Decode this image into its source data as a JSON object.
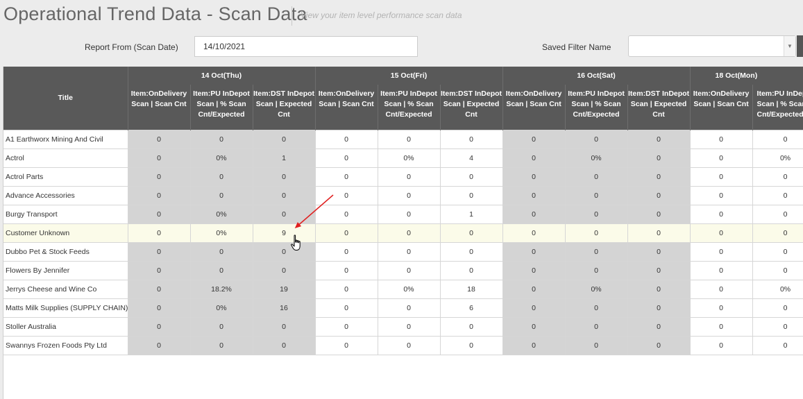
{
  "header": {
    "title": "Operational Trend Data - Scan Data",
    "subtitle": "View your item level performance scan data"
  },
  "filters": {
    "report_from_label": "Report From (Scan Date)",
    "report_from_value": "14/10/2021",
    "saved_filter_label": "Saved Filter Name",
    "saved_filter_value": ""
  },
  "table": {
    "title_header": "Title",
    "groups": [
      "14 Oct(Thu)",
      "15 Oct(Fri)",
      "16 Oct(Sat)",
      "18 Oct(Mon)"
    ],
    "subcolumns": [
      "Item:OnDelivery Scan | Scan Cnt",
      "Item:PU InDepot Scan | % Scan Cnt/Expected",
      "Item:DST InDepot Scan | Expected Cnt"
    ],
    "rows": [
      {
        "name": "A1 Earthworx Mining And Civil",
        "values": [
          "0",
          "0",
          "0",
          "0",
          "0",
          "0",
          "0",
          "0",
          "0",
          "0",
          "0"
        ]
      },
      {
        "name": "Actrol",
        "values": [
          "0",
          "0%",
          "1",
          "0",
          "0%",
          "4",
          "0",
          "0%",
          "0",
          "0",
          "0%"
        ]
      },
      {
        "name": "Actrol Parts",
        "values": [
          "0",
          "0",
          "0",
          "0",
          "0",
          "0",
          "0",
          "0",
          "0",
          "0",
          "0"
        ]
      },
      {
        "name": "Advance Accessories",
        "values": [
          "0",
          "0",
          "0",
          "0",
          "0",
          "0",
          "0",
          "0",
          "0",
          "0",
          "0"
        ]
      },
      {
        "name": "Burgy Transport",
        "values": [
          "0",
          "0%",
          "0",
          "0",
          "0",
          "1",
          "0",
          "0",
          "0",
          "0",
          "0"
        ]
      },
      {
        "name": "Customer Unknown",
        "values": [
          "0",
          "0%",
          "9",
          "0",
          "0",
          "0",
          "0",
          "0",
          "0",
          "0",
          "0"
        ]
      },
      {
        "name": "Dubbo Pet & Stock Feeds",
        "values": [
          "0",
          "0",
          "0",
          "0",
          "0",
          "0",
          "0",
          "0",
          "0",
          "0",
          "0"
        ]
      },
      {
        "name": "Flowers By Jennifer",
        "values": [
          "0",
          "0",
          "0",
          "0",
          "0",
          "0",
          "0",
          "0",
          "0",
          "0",
          "0"
        ]
      },
      {
        "name": "Jerrys Cheese and Wine Co",
        "values": [
          "0",
          "18.2%",
          "19",
          "0",
          "0%",
          "18",
          "0",
          "0%",
          "0",
          "0",
          "0%"
        ]
      },
      {
        "name": "Matts Milk Supplies (SUPPLY CHAIN)",
        "values": [
          "0",
          "0%",
          "16",
          "0",
          "0",
          "6",
          "0",
          "0",
          "0",
          "0",
          "0"
        ]
      },
      {
        "name": "Stoller Australia",
        "values": [
          "0",
          "0",
          "0",
          "0",
          "0",
          "0",
          "0",
          "0",
          "0",
          "0",
          "0"
        ]
      },
      {
        "name": "Swannys Frozen Foods Pty Ltd",
        "values": [
          "0",
          "0",
          "0",
          "0",
          "0",
          "0",
          "0",
          "0",
          "0",
          "0",
          "0"
        ]
      }
    ]
  },
  "annotation": {
    "arrow_color": "#e02020"
  }
}
